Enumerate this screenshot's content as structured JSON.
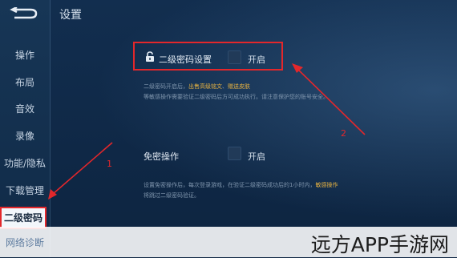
{
  "header": {
    "title": "设置"
  },
  "sidebar": {
    "items": [
      {
        "label": "操作"
      },
      {
        "label": "布局"
      },
      {
        "label": "音效"
      },
      {
        "label": "录像"
      },
      {
        "label": "功能/隐私"
      },
      {
        "label": "下载管理"
      },
      {
        "label": "二级密码",
        "active": true
      },
      {
        "label": "网络诊断"
      }
    ]
  },
  "settings": {
    "second_password": {
      "label": "二级密码设置",
      "toggle_label": "开启",
      "desc_line1_prefix": "二级密码开启后，",
      "desc_line1_hl1": "出售高级铭文",
      "desc_line1_sep": "、",
      "desc_line1_hl2": "赠送皮肤",
      "desc_line2": "等敏感操作需要验证二级密码后方可成功执行。请注意保护您的账号安全。"
    },
    "free_password": {
      "label": "免密操作",
      "toggle_label": "开启",
      "desc_line1_prefix": "设置免密操作后，每次登录游戏，在验证二级密码成功后的1小时内，",
      "desc_line1_hl": "敏感操作",
      "desc_line2": "将跳过二级密码验证。"
    }
  },
  "annotations": {
    "arrow1": "1",
    "arrow2": "2"
  },
  "watermark": {
    "text": "远方APP手游网"
  },
  "colors": {
    "accent_red": "#e3272b",
    "highlight": "#e8b342",
    "background": "#0f2744"
  }
}
